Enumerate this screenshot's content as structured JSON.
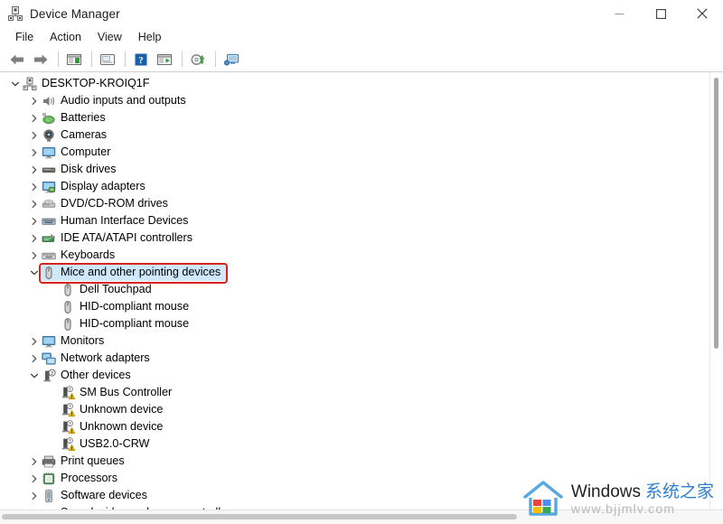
{
  "window": {
    "title": "Device Manager",
    "icon": "device-manager-icon",
    "buttons": {
      "minimize": "minimize-icon",
      "maximize": "maximize-icon",
      "close": "close-icon"
    }
  },
  "menubar": {
    "items": [
      {
        "label": "File"
      },
      {
        "label": "Action"
      },
      {
        "label": "View"
      },
      {
        "label": "Help"
      }
    ]
  },
  "toolbar": {
    "buttons": [
      {
        "name": "back-arrow-icon",
        "tooltip": "Back"
      },
      {
        "name": "forward-arrow-icon",
        "tooltip": "Forward"
      },
      {
        "name": "separator-1",
        "tooltip": ""
      },
      {
        "name": "show-hide-console-tree-icon",
        "tooltip": "Show/Hide Console Tree"
      },
      {
        "name": "separator-2",
        "tooltip": ""
      },
      {
        "name": "properties-icon",
        "tooltip": "Properties"
      },
      {
        "name": "separator-3",
        "tooltip": ""
      },
      {
        "name": "help-icon",
        "tooltip": "Help"
      },
      {
        "name": "display-window-icon",
        "tooltip": "Display"
      },
      {
        "name": "separator-4",
        "tooltip": ""
      },
      {
        "name": "update-driver-icon",
        "tooltip": "Update Driver Software"
      },
      {
        "name": "separator-5",
        "tooltip": ""
      },
      {
        "name": "scan-hardware-changes-icon",
        "tooltip": "Scan for hardware changes"
      }
    ]
  },
  "tree": {
    "rows": [
      {
        "label": "DESKTOP-KROIQ1F",
        "depth": 0,
        "twisty": "expanded",
        "icon": "computer-root-icon",
        "selected": false
      },
      {
        "label": "Audio inputs and outputs",
        "depth": 1,
        "twisty": "collapsed",
        "icon": "speaker-icon",
        "selected": false
      },
      {
        "label": "Batteries",
        "depth": 1,
        "twisty": "collapsed",
        "icon": "battery-icon",
        "selected": false
      },
      {
        "label": "Cameras",
        "depth": 1,
        "twisty": "collapsed",
        "icon": "camera-icon",
        "selected": false
      },
      {
        "label": "Computer",
        "depth": 1,
        "twisty": "collapsed",
        "icon": "monitor-icon",
        "selected": false
      },
      {
        "label": "Disk drives",
        "depth": 1,
        "twisty": "collapsed",
        "icon": "disk-drive-icon",
        "selected": false
      },
      {
        "label": "Display adapters",
        "depth": 1,
        "twisty": "collapsed",
        "icon": "display-adapter-icon",
        "selected": false
      },
      {
        "label": "DVD/CD-ROM drives",
        "depth": 1,
        "twisty": "collapsed",
        "icon": "dvd-drive-icon",
        "selected": false
      },
      {
        "label": "Human Interface Devices",
        "depth": 1,
        "twisty": "collapsed",
        "icon": "hid-icon",
        "selected": false
      },
      {
        "label": "IDE ATA/ATAPI controllers",
        "depth": 1,
        "twisty": "collapsed",
        "icon": "ide-controller-icon",
        "selected": false
      },
      {
        "label": "Keyboards",
        "depth": 1,
        "twisty": "collapsed",
        "icon": "keyboard-icon",
        "selected": false
      },
      {
        "label": "Mice and other pointing devices",
        "depth": 1,
        "twisty": "expanded",
        "icon": "mouse-icon",
        "selected": true
      },
      {
        "label": "Dell Touchpad",
        "depth": 2,
        "twisty": "none",
        "icon": "mouse-icon",
        "selected": false
      },
      {
        "label": "HID-compliant mouse",
        "depth": 2,
        "twisty": "none",
        "icon": "mouse-icon",
        "selected": false
      },
      {
        "label": "HID-compliant mouse",
        "depth": 2,
        "twisty": "none",
        "icon": "mouse-icon",
        "selected": false
      },
      {
        "label": "Monitors",
        "depth": 1,
        "twisty": "collapsed",
        "icon": "monitor-icon",
        "selected": false
      },
      {
        "label": "Network adapters",
        "depth": 1,
        "twisty": "collapsed",
        "icon": "network-adapter-icon",
        "selected": false
      },
      {
        "label": "Other devices",
        "depth": 1,
        "twisty": "expanded",
        "icon": "other-device-icon",
        "selected": false
      },
      {
        "label": "SM Bus Controller",
        "depth": 2,
        "twisty": "none",
        "icon": "unknown-device-warning-icon",
        "selected": false
      },
      {
        "label": "Unknown device",
        "depth": 2,
        "twisty": "none",
        "icon": "unknown-device-warning-icon",
        "selected": false
      },
      {
        "label": "Unknown device",
        "depth": 2,
        "twisty": "none",
        "icon": "unknown-device-warning-icon",
        "selected": false
      },
      {
        "label": "USB2.0-CRW",
        "depth": 2,
        "twisty": "none",
        "icon": "unknown-device-warning-icon",
        "selected": false
      },
      {
        "label": "Print queues",
        "depth": 1,
        "twisty": "collapsed",
        "icon": "printer-icon",
        "selected": false
      },
      {
        "label": "Processors",
        "depth": 1,
        "twisty": "collapsed",
        "icon": "processor-icon",
        "selected": false
      },
      {
        "label": "Software devices",
        "depth": 1,
        "twisty": "collapsed",
        "icon": "software-device-icon",
        "selected": false
      },
      {
        "label": "Sound, video and game controllers",
        "depth": 1,
        "twisty": "collapsed",
        "icon": "sound-controller-icon",
        "selected": false
      }
    ]
  },
  "annotation": {
    "target_label": "Mice and other pointing devices",
    "color": "#d62419"
  },
  "watermark": {
    "brand": "Windows",
    "brand_cn": "系统之家",
    "url": "www.bjjmlv.com",
    "logo": "windows-house-logo"
  },
  "colors": {
    "selection": "#cfe8fb",
    "annotation": "#d62419",
    "text": "#000000",
    "accent_blue": "#2f7fd0"
  }
}
